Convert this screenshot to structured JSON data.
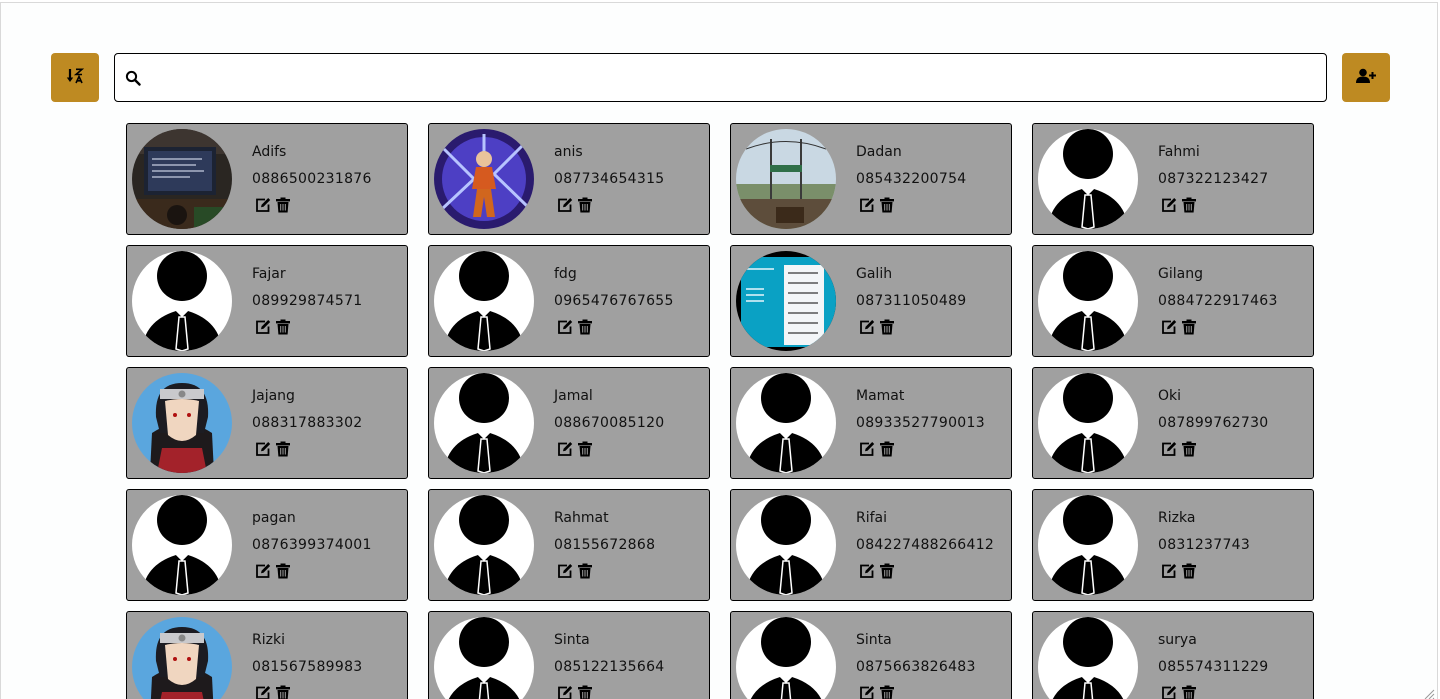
{
  "toolbar": {
    "sort_icon": "sort-alpha-icon",
    "add_icon": "user-plus-icon",
    "search": {
      "icon": "search-icon",
      "value": "",
      "placeholder": ""
    },
    "accent_color": "#be8a22"
  },
  "card_color": "#a0a0a0",
  "contacts": [
    {
      "name": "Adifs",
      "phone": "0886500231876",
      "photo": "photo-screen"
    },
    {
      "name": "anis",
      "phone": "087734654315",
      "photo": "photo-anime-aura"
    },
    {
      "name": "Dadan",
      "phone": "085432200754",
      "photo": "photo-landscape"
    },
    {
      "name": "Fahmi",
      "phone": "087322123427",
      "photo": "default"
    },
    {
      "name": "Fajar",
      "phone": "089929874571",
      "photo": "default"
    },
    {
      "name": "fdg",
      "phone": "0965476767655",
      "photo": "default"
    },
    {
      "name": "Galih",
      "phone": "087311050489",
      "photo": "photo-document"
    },
    {
      "name": "Gilang",
      "phone": "0884722917463",
      "photo": "default"
    },
    {
      "name": "Jajang",
      "phone": "088317883302",
      "photo": "photo-anime-ninja"
    },
    {
      "name": "Jamal",
      "phone": "088670085120",
      "photo": "default"
    },
    {
      "name": "Mamat",
      "phone": "08933527790013",
      "photo": "default"
    },
    {
      "name": "Oki",
      "phone": "087899762730",
      "photo": "default"
    },
    {
      "name": "pagan",
      "phone": "0876399374001",
      "photo": "default"
    },
    {
      "name": "Rahmat",
      "phone": "08155672868",
      "photo": "default"
    },
    {
      "name": "Rifai",
      "phone": "084227488266412",
      "photo": "default"
    },
    {
      "name": "Rizka",
      "phone": "0831237743",
      "photo": "default"
    },
    {
      "name": "Rizki",
      "phone": "081567589983",
      "photo": "photo-anime-ninja"
    },
    {
      "name": "Sinta",
      "phone": "085122135664",
      "photo": "default"
    },
    {
      "name": "Sinta",
      "phone": "0875663826483",
      "photo": "default"
    },
    {
      "name": "surya",
      "phone": "085574311229",
      "photo": "default"
    }
  ]
}
